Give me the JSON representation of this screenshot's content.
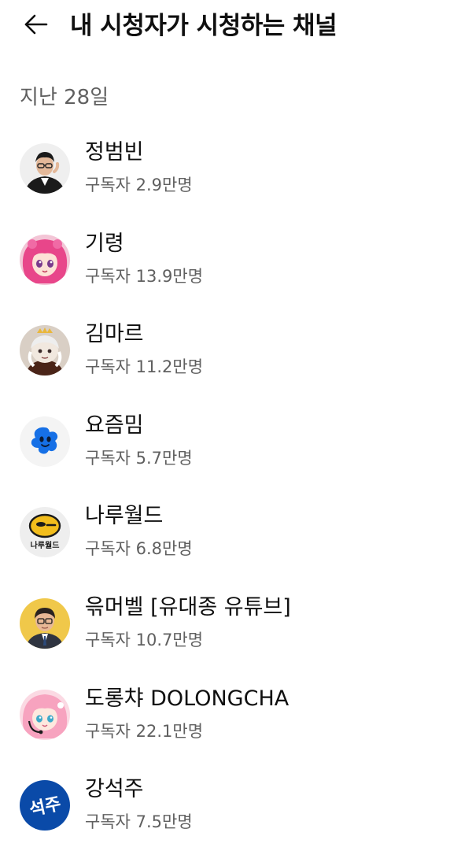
{
  "header": {
    "back_icon": "arrow-left-icon",
    "title": "내 시청자가 시청하는 채널"
  },
  "section": {
    "label": "지난 28일"
  },
  "channels": [
    {
      "name": "정범빈",
      "subscribers": "구독자 2.9만명",
      "avatar": "person-photo-avatar"
    },
    {
      "name": "기령",
      "subscribers": "구독자 13.9만명",
      "avatar": "pink-hair-anime-avatar"
    },
    {
      "name": "김마르",
      "subscribers": "구독자 11.2만명",
      "avatar": "crowned-character-avatar"
    },
    {
      "name": "요즘밈",
      "subscribers": "구독자 5.7만명",
      "avatar": "blue-star-logo-avatar"
    },
    {
      "name": "나루월드",
      "subscribers": "구독자 6.8만명",
      "avatar": "naru-world-logo-avatar",
      "avatar_text": "나루월드"
    },
    {
      "name": "윾머벨 [유대종 유튜브]",
      "subscribers": "구독자 10.7만명",
      "avatar": "man-with-glasses-avatar"
    },
    {
      "name": "도롱챠 DOLONGCHA",
      "subscribers": "구독자 22.1만명",
      "avatar": "pink-hair-headset-avatar"
    },
    {
      "name": "강석주",
      "subscribers": "구독자 7.5만명",
      "avatar": "seokju-logo-avatar",
      "avatar_text": "석주"
    }
  ],
  "colors": {
    "primary_text": "#0f0f0f",
    "secondary_text": "#606060",
    "background": "#ffffff",
    "logo_blue": "#0a4aa8",
    "naru_yellow": "#f2bd1c"
  }
}
